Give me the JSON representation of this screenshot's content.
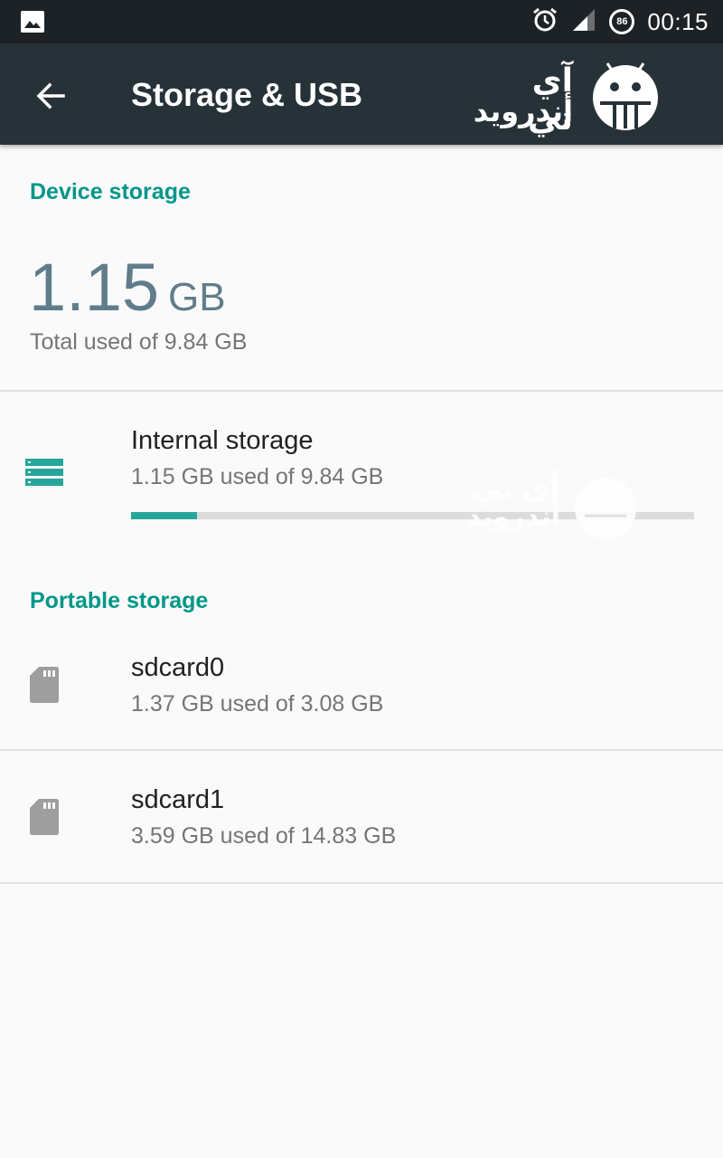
{
  "status_bar": {
    "time": "00:15",
    "battery_level": "86",
    "icons": [
      "image-icon",
      "alarm-icon",
      "signal-icon",
      "battery-icon"
    ]
  },
  "app_bar": {
    "title": "Storage & USB",
    "brand_line1": "آي تي",
    "brand_line2": "أندرويد"
  },
  "device_storage": {
    "header": "Device storage",
    "total_value": "1.15",
    "total_unit": "GB",
    "total_caption": "Total used of 9.84 GB",
    "internal": {
      "title": "Internal storage",
      "summary": "1.15 GB used of 9.84 GB",
      "used_fraction": 0.117
    }
  },
  "portable_storage": {
    "header": "Portable storage",
    "items": [
      {
        "title": "sdcard0",
        "summary": "1.37 GB used of 3.08 GB"
      },
      {
        "title": "sdcard1",
        "summary": "3.59 GB used of 14.83 GB"
      }
    ]
  },
  "colors": {
    "accent": "#009688",
    "progress": "#26a69a",
    "app_bar": "#263238",
    "status_bar": "#1c2226"
  }
}
